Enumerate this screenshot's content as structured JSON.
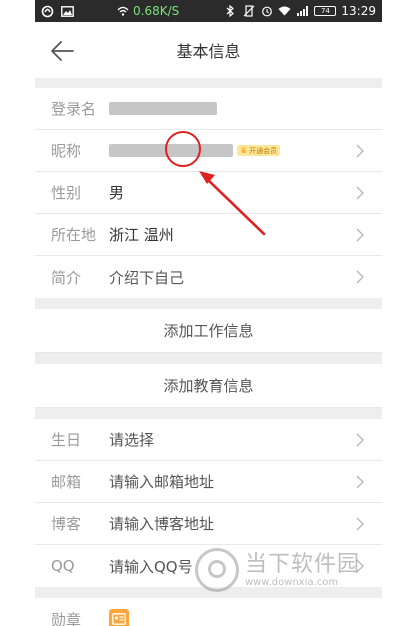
{
  "status_bar": {
    "net_speed": "0.68K/S",
    "time": "13:29",
    "battery": "74"
  },
  "header": {
    "title": "基本信息"
  },
  "profile_rows": [
    {
      "label": "登录名",
      "value": ""
    },
    {
      "label": "昵称",
      "value": "",
      "badge": "开通会员"
    },
    {
      "label": "性别",
      "value": "男"
    },
    {
      "label": "所在地",
      "value": "浙江 温州"
    },
    {
      "label": "简介",
      "value": "介绍下自己"
    }
  ],
  "actions": {
    "add_work": "添加工作信息",
    "add_education": "添加教育信息"
  },
  "contact_rows": [
    {
      "label": "生日",
      "value": "请选择"
    },
    {
      "label": "邮箱",
      "value": "请输入邮箱地址"
    },
    {
      "label": "博客",
      "value": "请输入博客地址"
    },
    {
      "label": "QQ",
      "value": "请输入QQ号"
    }
  ],
  "medal_row": {
    "label": "勋章"
  },
  "watermark": {
    "title": "当下软件园",
    "url": "www.downxia.com"
  },
  "colors": {
    "annotation_red": "#e02020",
    "medal_orange": "#ffa63a",
    "status_bar_bg": "#2b2b2b"
  }
}
